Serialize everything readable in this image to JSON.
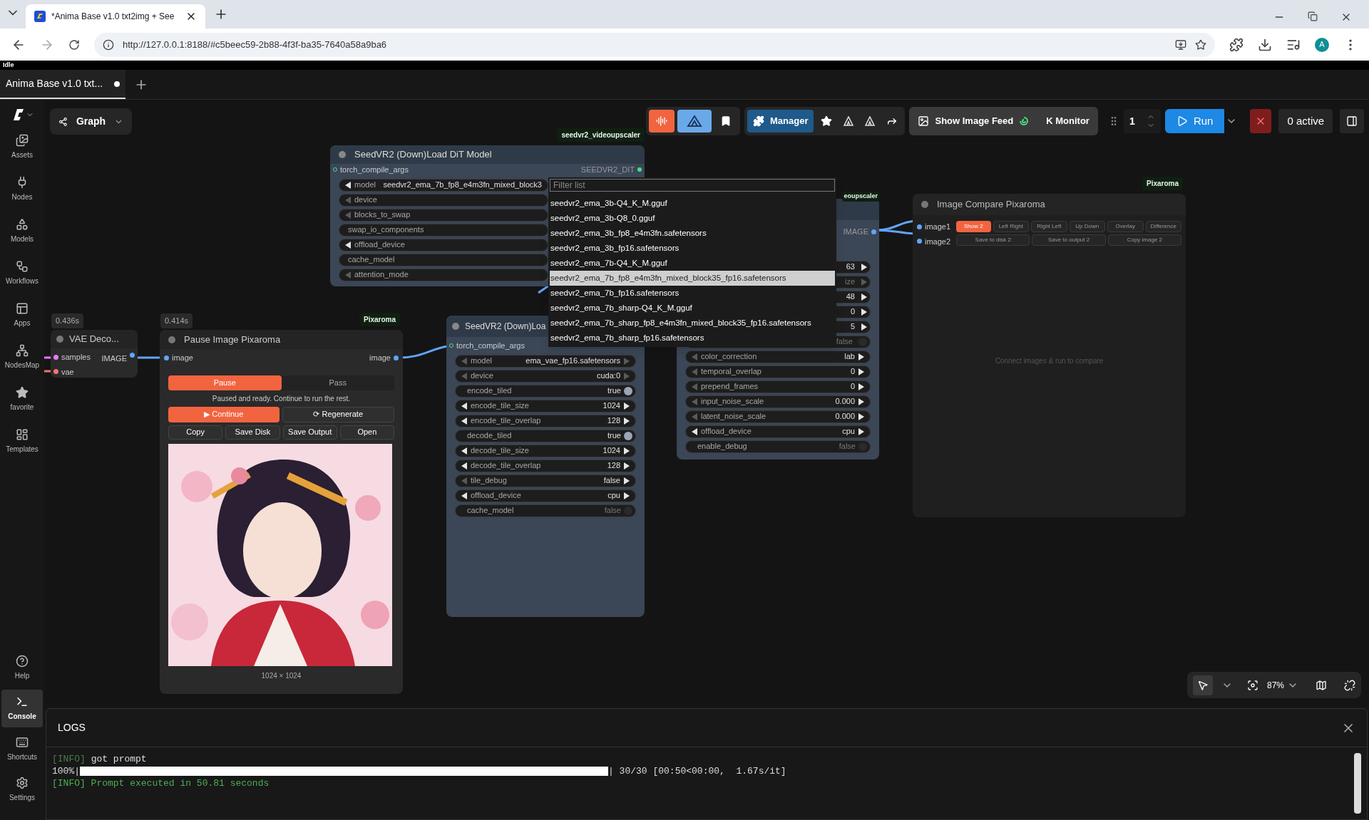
{
  "browser": {
    "tab_title": "*Anima Base v1.0 txt2img + See",
    "url": "http://127.0.0.1:8188/#c5beec59-2b88-4f3f-ba35-7640a58a9ba6",
    "profile": "A"
  },
  "status": "Idle",
  "workflow_tabs": [
    {
      "label": "Anima Base v1.0 txt...",
      "selected": true,
      "unsaved": true
    }
  ],
  "sidebar": {
    "top": [
      {
        "label": "Assets",
        "selected": false
      },
      {
        "label": "Nodes",
        "selected": false
      },
      {
        "label": "Models",
        "selected": false
      },
      {
        "label": "Workflows",
        "selected": false
      },
      {
        "label": "Apps",
        "selected": false
      },
      {
        "label": "NodesMap",
        "selected": false
      },
      {
        "label": "favorite",
        "selected": false
      },
      {
        "label": "Templates",
        "selected": false
      }
    ],
    "bottom": [
      {
        "label": "Help",
        "selected": false
      },
      {
        "label": "Console",
        "selected": true
      },
      {
        "label": "Shortcuts",
        "selected": false
      },
      {
        "label": "Settings",
        "selected": false
      }
    ]
  },
  "graph_button": "Graph",
  "toolbar": {
    "manager": "Manager",
    "image_feed": "Show Image Feed",
    "monitor": "K Monitor",
    "queue_count": "1",
    "run": "Run",
    "active": "0 active"
  },
  "vae_decode": {
    "time": "0.436s",
    "title": "VAE Deco...",
    "inputs": [
      {
        "label": "samples",
        "color": "#e879f9"
      },
      {
        "label": "vae",
        "color": "#f87171"
      }
    ],
    "output": "IMAGE"
  },
  "pause_node": {
    "badge": "Pixaroma",
    "time": "0.414s",
    "title": "Pause Image Pixaroma",
    "input": "image",
    "output": "image",
    "modes": [
      {
        "label": "Pause",
        "selected": true
      },
      {
        "label": "Pass",
        "selected": false
      }
    ],
    "message": "Paused and ready. Continue to run the rest.",
    "continue": "▶ Continue",
    "regenerate": "⟳ Regenerate",
    "actions": [
      "Copy",
      "Save Disk",
      "Save Output",
      "Open"
    ],
    "caption": "1024 × 1024"
  },
  "dit_node": {
    "badge": "seedvr2_videoupscaler",
    "title": "SeedVR2 (Down)Load DiT Model",
    "input": "torch_compile_args",
    "output": "SEEDVR2_DIT",
    "widgets": [
      {
        "kind": "combo",
        "label": "model",
        "value": "seedvr2_ema_7b_fp8_e4m3fn_mixed_block3",
        "prev_enabled": true
      },
      {
        "kind": "combo",
        "label": "device",
        "prev_enabled": false
      },
      {
        "kind": "combo",
        "label": "blocks_to_swap",
        "prev_enabled": false
      },
      {
        "kind": "plain",
        "label": "swap_io_components"
      },
      {
        "kind": "combo",
        "label": "offload_device",
        "prev_enabled": true
      },
      {
        "kind": "plain",
        "label": "cache_model"
      },
      {
        "kind": "combo",
        "label": "attention_mode",
        "prev_enabled": false
      }
    ]
  },
  "vae_node": {
    "title": "SeedVR2 (Down)Loa",
    "input": "torch_compile_args",
    "widgets": [
      {
        "kind": "combo",
        "label": "model",
        "value": "ema_vae_fp16.safetensors",
        "prev_enabled": false,
        "next_enabled": false
      },
      {
        "kind": "combo",
        "label": "device",
        "value": "cuda:0",
        "prev_enabled": false,
        "next_enabled": false
      },
      {
        "kind": "toggle",
        "label": "encode_tiled",
        "value": "true",
        "on": true
      },
      {
        "kind": "combo",
        "label": "encode_tile_size",
        "value": "1024",
        "prev_enabled": true,
        "next_enabled": true
      },
      {
        "kind": "combo",
        "label": "encode_tile_overlap",
        "value": "128",
        "prev_enabled": true,
        "next_enabled": true
      },
      {
        "kind": "toggle",
        "label": "decode_tiled",
        "value": "true",
        "on": true
      },
      {
        "kind": "combo",
        "label": "decode_tile_size",
        "value": "1024",
        "prev_enabled": true,
        "next_enabled": true
      },
      {
        "kind": "combo",
        "label": "decode_tile_overlap",
        "value": "128",
        "prev_enabled": true,
        "next_enabled": true
      },
      {
        "kind": "combo",
        "label": "tile_debug",
        "value": "false",
        "prev_enabled": false,
        "next_enabled": true
      },
      {
        "kind": "combo",
        "label": "offload_device",
        "value": "cpu",
        "prev_enabled": true,
        "next_enabled": true
      },
      {
        "kind": "toggle",
        "label": "cache_model",
        "value": "false",
        "on": false
      }
    ]
  },
  "upscaler_node": {
    "badge": "eoupscaler",
    "output": "IMAGE",
    "widgets": [
      {
        "kind": "clipped",
        "text": "63",
        "dim": false,
        "next_enabled": true
      },
      {
        "kind": "clipped",
        "text": "ize",
        "dim": true,
        "next_enabled": false
      },
      {
        "kind": "clipped",
        "text": "48",
        "dim": false,
        "next_enabled": true
      },
      {
        "kind": "clipped",
        "text": "0",
        "dim": false,
        "next_enabled": true
      },
      {
        "kind": "clipped",
        "text": "5",
        "dim": false,
        "next_enabled": true
      },
      {
        "kind": "clipped",
        "text": "false",
        "dim": true,
        "on": false
      },
      {
        "kind": "combo",
        "label": "color_correction",
        "value": "lab",
        "prev_enabled": false,
        "next_enabled": true
      },
      {
        "kind": "combo",
        "label": "temporal_overlap",
        "value": "0",
        "prev_enabled": false,
        "next_enabled": true
      },
      {
        "kind": "combo",
        "label": "prepend_frames",
        "value": "0",
        "prev_enabled": false,
        "next_enabled": true
      },
      {
        "kind": "combo",
        "label": "input_noise_scale",
        "value": "0.000",
        "prev_enabled": false,
        "next_enabled": true
      },
      {
        "kind": "combo",
        "label": "latent_noise_scale",
        "value": "0.000",
        "prev_enabled": false,
        "next_enabled": true
      },
      {
        "kind": "combo",
        "label": "offload_device",
        "value": "cpu",
        "prev_enabled": true,
        "next_enabled": true
      },
      {
        "kind": "toggle",
        "label": "enable_debug",
        "value": "false",
        "on": false
      }
    ]
  },
  "compare_node": {
    "badge": "Pixaroma",
    "title": "Image Compare Pixaroma",
    "inputs": [
      "image1",
      "image2"
    ],
    "modes": [
      {
        "label": "Show 2",
        "selected": true
      },
      {
        "label": "Left Right",
        "selected": false
      },
      {
        "label": "Right Left",
        "selected": false
      },
      {
        "label": "Up Down",
        "selected": false
      },
      {
        "label": "Overlay",
        "selected": false
      },
      {
        "label": "Difference",
        "selected": false
      }
    ],
    "actions": [
      "Save to disk 2",
      "Save to output 2",
      "Copy image 2"
    ],
    "placeholder": "Connect images & run to compare"
  },
  "dropdown": {
    "placeholder": "Filter list",
    "options": [
      {
        "label": "seedvr2_ema_3b-Q4_K_M.gguf",
        "selected": false
      },
      {
        "label": "seedvr2_ema_3b-Q8_0.gguf",
        "selected": false
      },
      {
        "label": "seedvr2_ema_3b_fp8_e4m3fn.safetensors",
        "selected": false
      },
      {
        "label": "seedvr2_ema_3b_fp16.safetensors",
        "selected": false
      },
      {
        "label": "seedvr2_ema_7b-Q4_K_M.gguf",
        "selected": false
      },
      {
        "label": "seedvr2_ema_7b_fp8_e4m3fn_mixed_block35_fp16.safetensors",
        "selected": true
      },
      {
        "label": "seedvr2_ema_7b_fp16.safetensors",
        "selected": false
      },
      {
        "label": "seedvr2_ema_7b_sharp-Q4_K_M.gguf",
        "selected": false
      },
      {
        "label": "seedvr2_ema_7b_sharp_fp8_e4m3fn_mixed_block35_fp16.safetensors",
        "selected": false
      },
      {
        "label": "seedvr2_ema_7b_sharp_fp16.safetensors",
        "selected": false
      }
    ]
  },
  "canvas_controls": {
    "zoom": "87%"
  },
  "logs": {
    "title": "LOGS",
    "lines": [
      {
        "kind": "info",
        "prefix": "[INFO]",
        "text": "got prompt"
      },
      {
        "kind": "progress",
        "prefix": "100%|",
        "text": "| 30/30 [00:50<00:00,  1.67s/it]"
      },
      {
        "kind": "success",
        "prefix": "[INFO]",
        "text": "Prompt executed in 50.81 seconds"
      }
    ]
  }
}
